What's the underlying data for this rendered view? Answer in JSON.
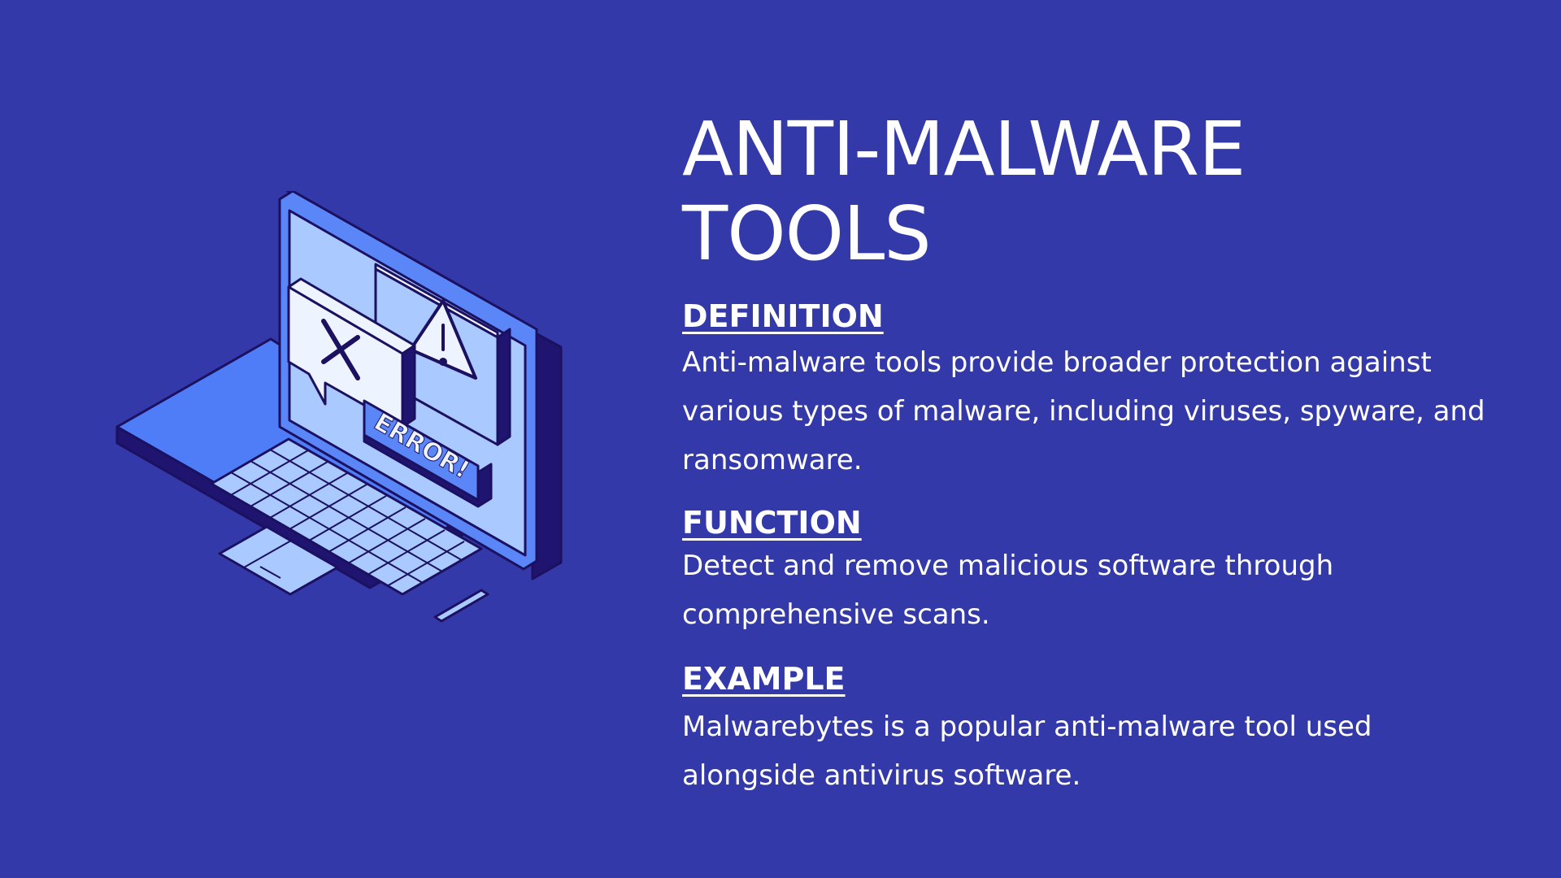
{
  "slide": {
    "title_line1": "ANTI-MALWARE",
    "title_line2": "TOOLS",
    "sections": [
      {
        "heading": "DEFINITION",
        "body": "Anti-malware tools provide broader protection against various types of malware, including viruses, spyware, and ransomware."
      },
      {
        "heading": "FUNCTION",
        "body": "Detect and remove malicious software through comprehensive scans."
      },
      {
        "heading": "EXAMPLE",
        "body": "Malwarebytes is a popular anti-malware tool used alongside antivirus software."
      }
    ]
  },
  "illustration": {
    "error_label": "ERROR!",
    "icons": [
      "laptop-icon",
      "close-icon",
      "warning-icon"
    ]
  },
  "colors": {
    "background": "#3339a8",
    "text": "#ffffff",
    "outline": "#1b1160",
    "laptop_blue": "#4f7cf7",
    "screen_light": "#a9c9ff",
    "popup_white": "#eef4ff"
  }
}
